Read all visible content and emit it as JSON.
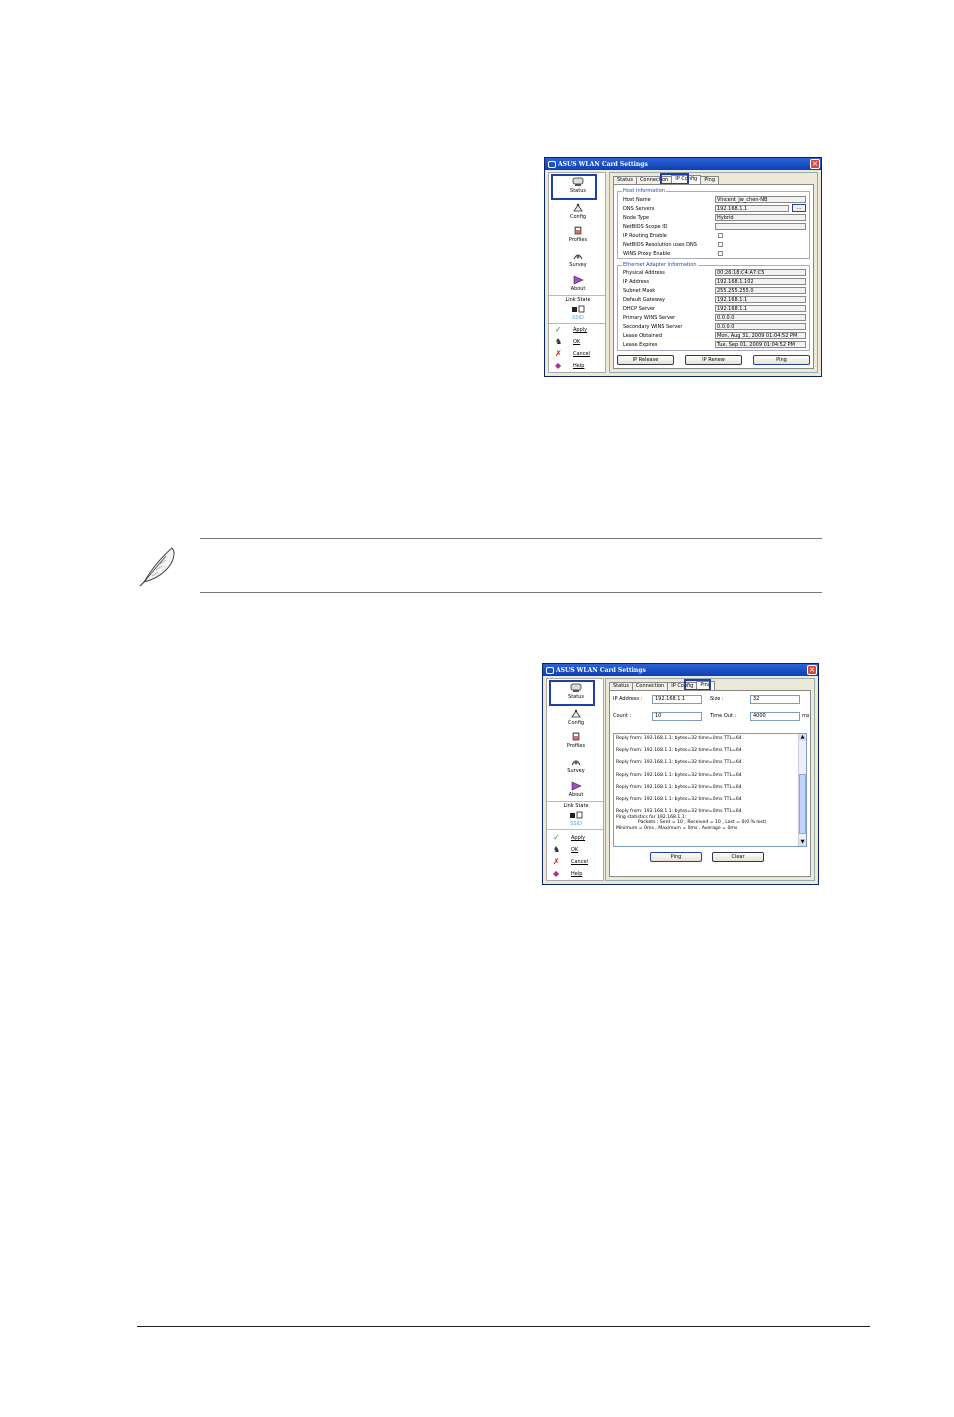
{
  "window1": {
    "title": "ASUS WLAN Card Settings",
    "sidebar": {
      "items": [
        {
          "label": "Status",
          "icon": "status-icon"
        },
        {
          "label": "Config",
          "icon": "config-icon"
        },
        {
          "label": "Profiles",
          "icon": "profiles-icon"
        },
        {
          "label": "Survey",
          "icon": "survey-icon"
        },
        {
          "label": "About",
          "icon": "about-icon"
        }
      ],
      "link_state_label": "Link State",
      "link_state_sub": "SSID",
      "actions": [
        {
          "label": "Apply",
          "icon": "check-icon"
        },
        {
          "label": "OK",
          "icon": "ok-icon"
        },
        {
          "label": "Cancel",
          "icon": "x-icon"
        },
        {
          "label": "Help",
          "icon": "help-book-icon"
        }
      ]
    },
    "tabs": [
      "Status",
      "Connection",
      "IP Config",
      "Ping"
    ],
    "active_tab": "IP Config",
    "host_group": {
      "title": "Host Information",
      "rows": [
        {
          "key": "Host Name",
          "value": "Vincent_jw_chen-NB"
        },
        {
          "key": "DNS Servers",
          "value": "192.168.1.1"
        },
        {
          "key": "Node Type",
          "value": "Hybrid"
        },
        {
          "key": "NetBIOS Scope ID",
          "value": ""
        },
        {
          "key": "IP Routing Enable",
          "value": ""
        },
        {
          "key": "NetBIOS Resolution uses DNS",
          "value": ""
        },
        {
          "key": "WINS Proxy Enable",
          "value": ""
        }
      ],
      "dns_more_button": "..."
    },
    "eth_group": {
      "title": "Ethernet Adapter Information",
      "rows": [
        {
          "key": "Physical Address",
          "value": "00:26:18:C4:A7:C5"
        },
        {
          "key": "IP Address",
          "value": "192.168.1.102"
        },
        {
          "key": "Subnet Mask",
          "value": "255.255.255.0"
        },
        {
          "key": "Default Gateway",
          "value": "192.168.1.1"
        },
        {
          "key": "DHCP Server",
          "value": "192.168.1.1"
        },
        {
          "key": "Primary WINS Server",
          "value": "0.0.0.0"
        },
        {
          "key": "Secondary WINS Server",
          "value": "0.0.0.0"
        },
        {
          "key": "Lease Obtained",
          "value": "Mon, Aug 31, 2009 01:04:52 PM"
        },
        {
          "key": "Lease Expires",
          "value": "Tue, Sep 01, 2009 01:04:52 PM"
        }
      ]
    },
    "buttons": {
      "release": "IP Release",
      "renew": "IP Renew",
      "ping": "Ping"
    }
  },
  "window2": {
    "title": "ASUS WLAN Card Settings",
    "tabs": [
      "Status",
      "Connection",
      "IP Config",
      "Ping"
    ],
    "active_tab": "Ping",
    "ip_label": "IP Address :",
    "ip_value": "192.168.1.1",
    "size_label": "Size :",
    "size_value": "32",
    "count_label": "Count :",
    "count_value": "10",
    "timeout_label": "Time Out :",
    "timeout_value": "4000",
    "timeout_unit": "ms",
    "log_lines": [
      "Reply from: 192.168.1.1: bytes=32 time=0ms TTL=64",
      "Reply from: 192.168.1.1: bytes=32 time=0ms TTL=64",
      "Reply from: 192.168.1.1: bytes=32 time=0ms TTL=64",
      "Reply from: 192.168.1.1: bytes=32 time=0ms TTL=64",
      "Reply from: 192.168.1.1: bytes=32 time=0ms TTL=64",
      "Reply from: 192.168.1.1: bytes=32 time=0ms TTL=64"
    ],
    "log_last_line": "Reply from: 192.168.1.1: bytes=32 time=0ms TTL=64",
    "log_stats_title": "Ping statistics for 192.168.1.1:",
    "log_stats_packets": "Packets : Sent = 10 , Received = 10 , Lost = 0(0 % lost)",
    "log_stats_times": "Minimum = 0ms , Maximum = 0ms , Average = 0ms",
    "buttons": {
      "ping": "Ping",
      "clear": "Clear"
    }
  },
  "colors": {
    "title_bar": "#0d3fb7",
    "highlight_box": "#1f3fa8",
    "window_bg": "#ece9d8"
  }
}
